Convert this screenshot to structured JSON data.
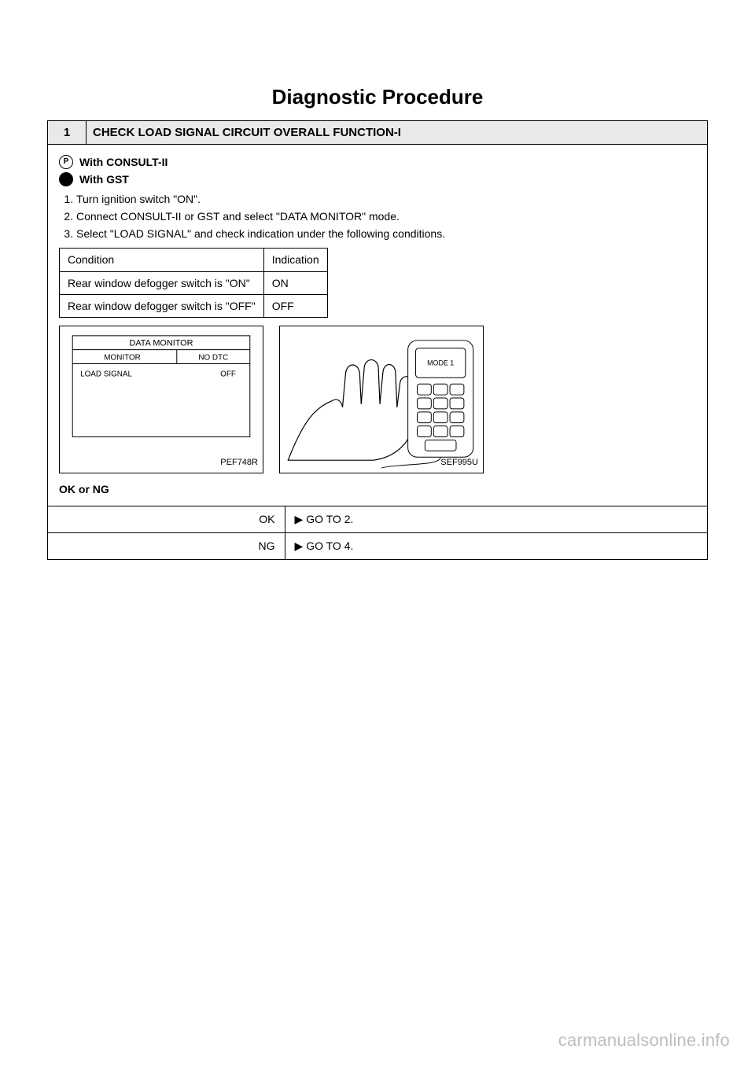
{
  "heading": "Diagnostic Procedure",
  "step": {
    "num": "1",
    "title": "CHECK LOAD SIGNAL CIRCUIT OVERALL FUNCTION-I",
    "consult_icon_text": "P",
    "with_consult": "With CONSULT-II",
    "with_gst": "With GST",
    "items": [
      "Turn ignition switch \"ON\".",
      "Connect CONSULT-II or GST and select \"DATA MONITOR\" mode.",
      "Select \"LOAD SIGNAL\" and check indication under the following conditions."
    ],
    "cond_headers": [
      "Condition",
      "Indication"
    ],
    "cond_rows": [
      [
        "Rear window defogger switch is \"ON\"",
        "ON"
      ],
      [
        "Rear window defogger switch is \"OFF\"",
        "OFF"
      ]
    ],
    "fig1": {
      "title": "DATA MONITOR",
      "sub": "MONITOR",
      "col2": "NO DTC",
      "item": "LOAD SIGNAL",
      "val": "OFF",
      "label": "PEF748R"
    },
    "fig2": {
      "mode": "MODE 1",
      "label": "SEF995U"
    },
    "ok_label": "OK or NG",
    "ok": {
      "left": "OK",
      "arrow": "▶",
      "right": "GO TO 2."
    },
    "ng": {
      "left": "NG",
      "arrow": "▶",
      "right": "GO TO 4."
    }
  },
  "watermark": "carmanualsonline.info"
}
